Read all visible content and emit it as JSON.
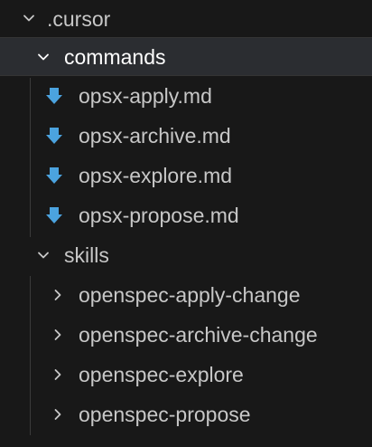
{
  "explorer": {
    "root": {
      "label": ".cursor",
      "chevron_icon": "chevron-down-icon"
    },
    "commands": {
      "label": "commands",
      "chevron_icon": "chevron-down-icon",
      "files": [
        {
          "label": "opsx-apply.md",
          "icon": "markdown-download-icon"
        },
        {
          "label": "opsx-archive.md",
          "icon": "markdown-download-icon"
        },
        {
          "label": "opsx-explore.md",
          "icon": "markdown-download-icon"
        },
        {
          "label": "opsx-propose.md",
          "icon": "markdown-download-icon"
        }
      ]
    },
    "skills": {
      "label": "skills",
      "chevron_icon": "chevron-down-icon",
      "folders": [
        {
          "label": "openspec-apply-change",
          "icon": "chevron-right-icon"
        },
        {
          "label": "openspec-archive-change",
          "icon": "chevron-right-icon"
        },
        {
          "label": "openspec-explore",
          "icon": "chevron-right-icon"
        },
        {
          "label": "openspec-propose",
          "icon": "chevron-right-icon"
        }
      ]
    },
    "bottom_partial_label": "",
    "colors": {
      "background": "#181818",
      "selected_background": "#2b2d31",
      "text": "#c7c7c7",
      "selected_text": "#ffffff",
      "icon_blue": "#4ba3df",
      "guide_line": "#3a3a3a"
    }
  }
}
